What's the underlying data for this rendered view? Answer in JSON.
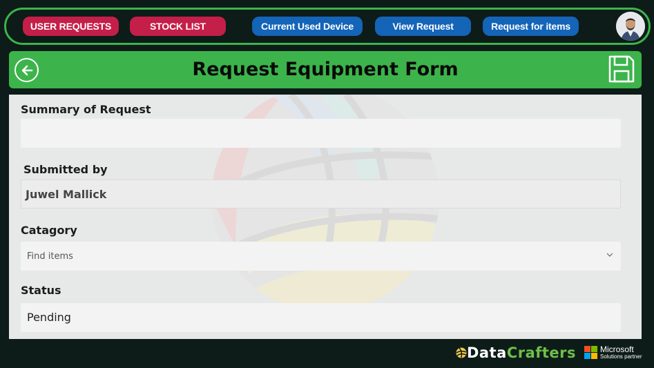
{
  "nav": {
    "user_requests": "USER REQUESTS",
    "stock_list": "STOCK LIST",
    "current_used_device": "Current Used Device",
    "view_request": "View Request",
    "request_for_items": "Request for items"
  },
  "header": {
    "title": "Request Equipment Form"
  },
  "form": {
    "summary_label": "Summary of Request",
    "summary_value": "",
    "submitted_by_label": "Submitted by",
    "submitted_by_value": "Juwel Mallick",
    "category_label": "Catagory",
    "category_placeholder": "Find items",
    "status_label": "Status",
    "status_value": "Pending"
  },
  "footer": {
    "brand_data": "Data",
    "brand_crafters": "Crafters",
    "partner_line1": "Microsoft",
    "partner_line2": "Solutions partner"
  },
  "colors": {
    "accent_green": "#3cb44b",
    "nav_red": "#c41f49",
    "nav_blue": "#1464b8",
    "background": "#0d1c18"
  },
  "icons": [
    "back-arrow-icon",
    "save-icon",
    "chevron-down-icon",
    "user-avatar",
    "microsoft-logo"
  ]
}
